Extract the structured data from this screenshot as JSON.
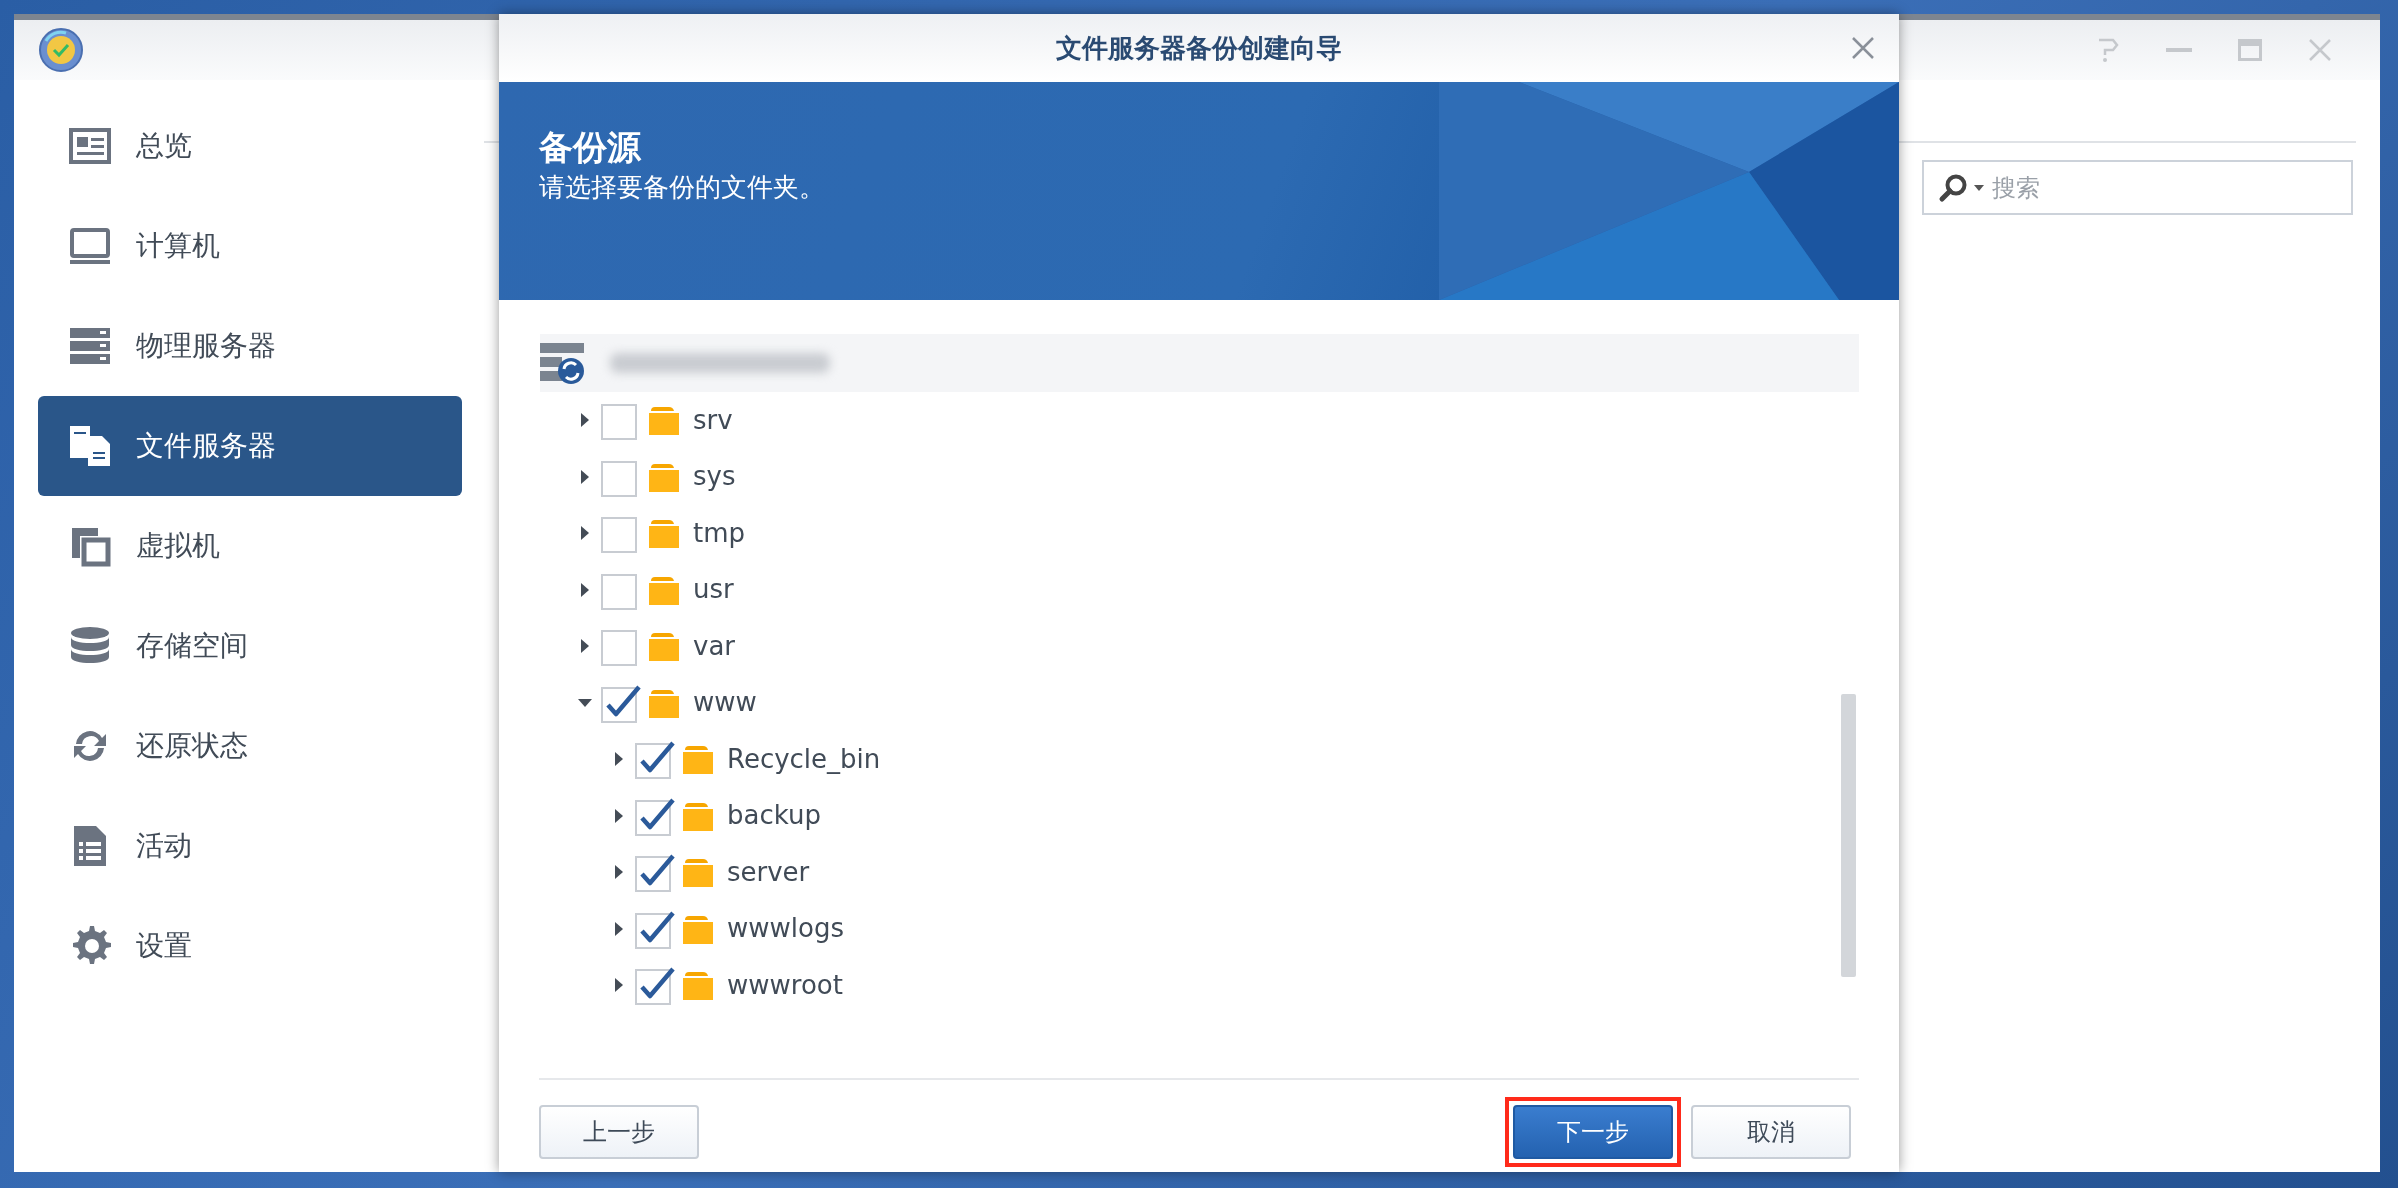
{
  "sidebar": {
    "items": [
      {
        "label": "总览",
        "selected": false
      },
      {
        "label": "计算机",
        "selected": false
      },
      {
        "label": "物理服务器",
        "selected": false
      },
      {
        "label": "文件服务器",
        "selected": true
      },
      {
        "label": "虚拟机",
        "selected": false
      },
      {
        "label": "存储空间",
        "selected": false
      },
      {
        "label": "还原状态",
        "selected": false
      },
      {
        "label": "活动",
        "selected": false
      },
      {
        "label": "设置",
        "selected": false
      }
    ]
  },
  "search": {
    "placeholder": "搜索"
  },
  "dialog": {
    "title": "文件服务器备份创建向导",
    "header": {
      "heading": "备份源",
      "subtitle": "请选择要备份的文件夹。"
    },
    "tree": {
      "items": [
        {
          "label": "srv",
          "checked": false,
          "expanded": false
        },
        {
          "label": "sys",
          "checked": false,
          "expanded": false
        },
        {
          "label": "tmp",
          "checked": false,
          "expanded": false
        },
        {
          "label": "usr",
          "checked": false,
          "expanded": false
        },
        {
          "label": "var",
          "checked": false,
          "expanded": false
        },
        {
          "label": "www",
          "checked": true,
          "expanded": true,
          "children": [
            {
              "label": "Recycle_bin",
              "checked": true,
              "expanded": false
            },
            {
              "label": "backup",
              "checked": true,
              "expanded": false
            },
            {
              "label": "server",
              "checked": true,
              "expanded": false
            },
            {
              "label": "wwwlogs",
              "checked": true,
              "expanded": false
            },
            {
              "label": "wwwroot",
              "checked": true,
              "expanded": false
            }
          ]
        }
      ]
    },
    "buttons": [
      {
        "label": "上一步",
        "kind": "secondary",
        "highlighted": false
      },
      {
        "label": "下一步",
        "kind": "primary",
        "highlighted": true
      },
      {
        "label": "取消",
        "kind": "secondary",
        "highlighted": false
      }
    ]
  }
}
